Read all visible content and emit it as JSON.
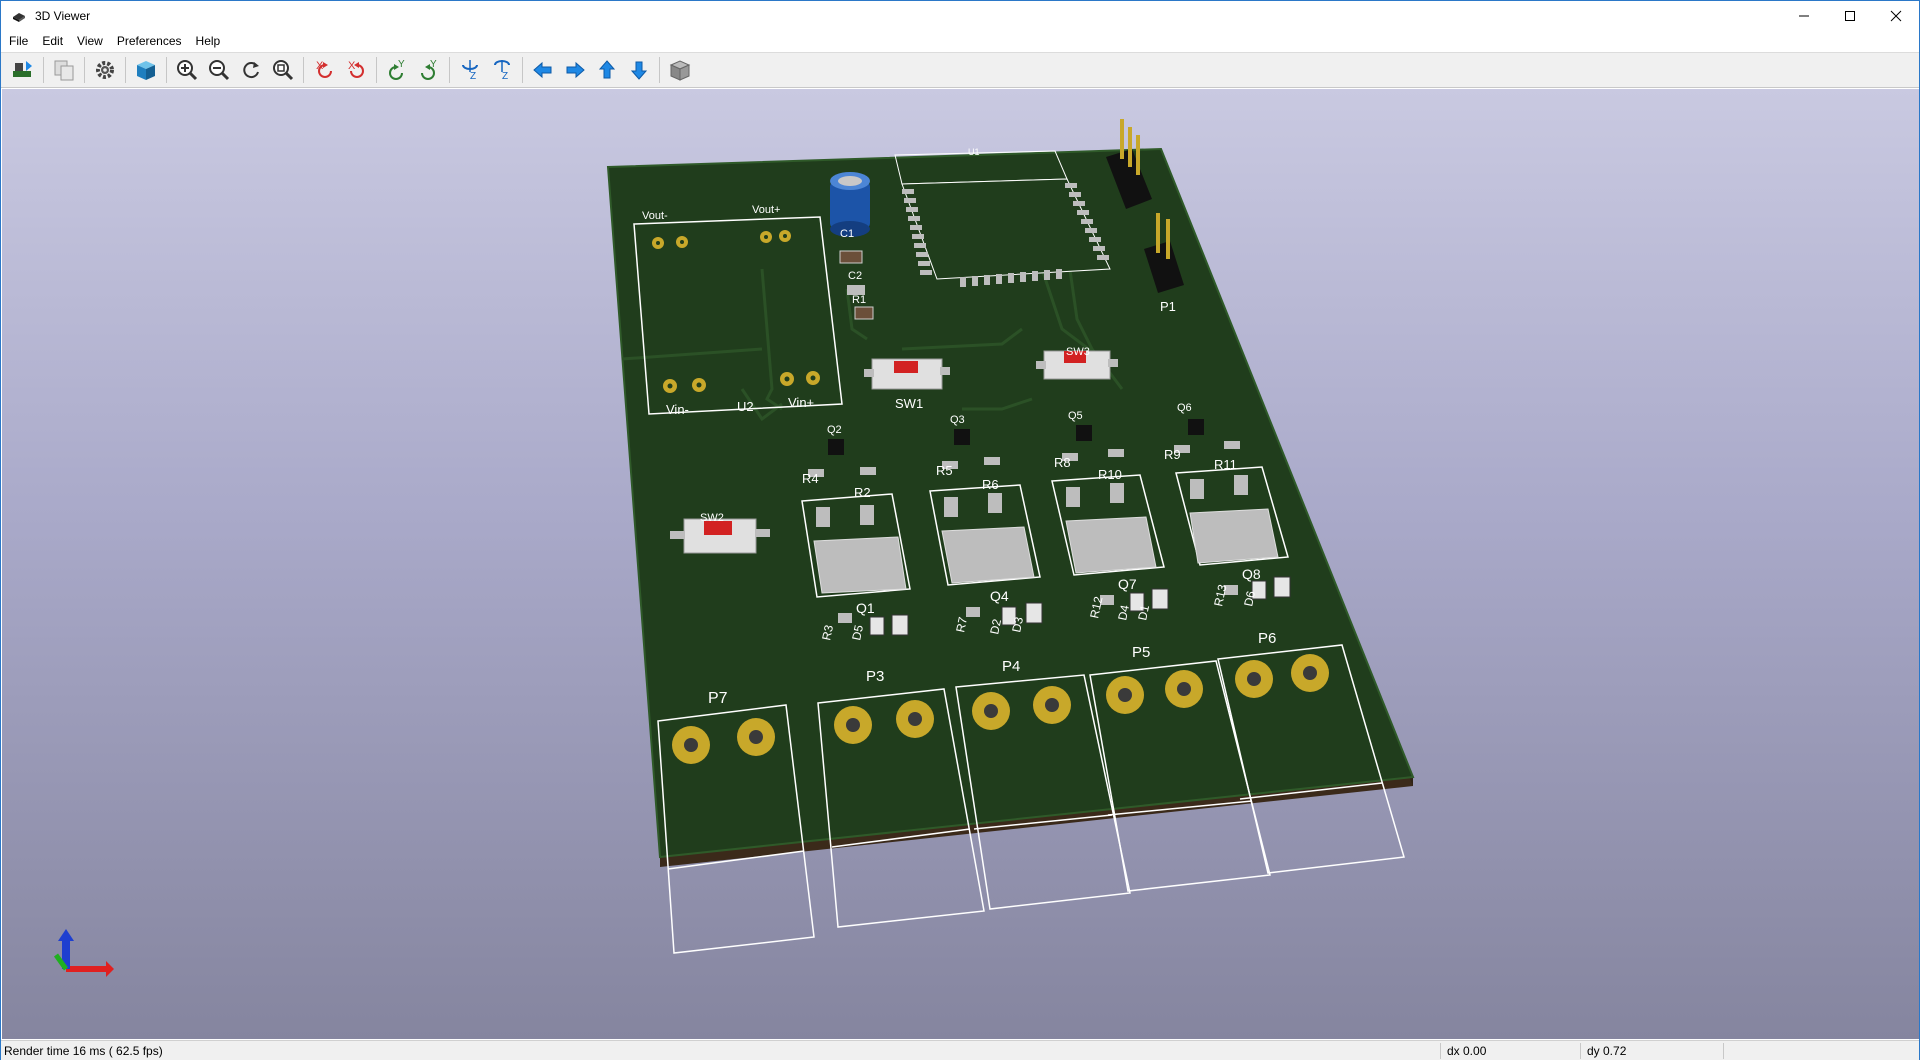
{
  "window": {
    "title": "3D Viewer",
    "icons": {
      "app": "3d-viewer-app-icon",
      "minimize": "minimize-icon",
      "maximize": "maximize-icon",
      "close": "close-icon"
    }
  },
  "menu": [
    "File",
    "Edit",
    "View",
    "Preferences",
    "Help"
  ],
  "toolbar": {
    "buttons": [
      "reload-board-icon",
      "copy-to-clipboard-icon",
      "settings-gear-icon",
      "raytracing-cube-icon",
      "zoom-in-icon",
      "zoom-out-icon",
      "redraw-icon",
      "zoom-fit-icon",
      "rotate-x-cw-icon",
      "rotate-x-ccw-icon",
      "rotate-y-cw-icon",
      "rotate-y-ccw-icon",
      "rotate-z-cw-icon",
      "rotate-z-ccw-icon",
      "pan-left-icon",
      "pan-right-icon",
      "pan-up-icon",
      "pan-down-icon",
      "ortho-view-icon"
    ]
  },
  "pcb": {
    "labels": {
      "vout_minus": "Vout-",
      "vout_plus": "Vout+",
      "vin_minus": "Vin-",
      "vin_plus": "Vin+",
      "u2": "U2",
      "u1": "U1",
      "c1": "C1",
      "c2": "C2",
      "r1": "R1",
      "sw1": "SW1",
      "sw2": "SW2",
      "sw3": "SW3",
      "p1": "P1",
      "q1": "Q1",
      "q2": "Q2",
      "q3": "Q3",
      "q4": "Q4",
      "q5": "Q5",
      "q6": "Q6",
      "q7": "Q7",
      "q8": "Q8",
      "r2": "R2",
      "r3": "R3",
      "r4": "R4",
      "r5": "R5",
      "r6": "R6",
      "r7": "R7",
      "r8": "R8",
      "r9": "R9",
      "r10": "R10",
      "r11": "R11",
      "r12": "R12",
      "r13": "R13",
      "d1": "D1",
      "d2": "D2",
      "d3": "D3",
      "d4": "D4",
      "d5": "D5",
      "d6": "D6",
      "p3": "P3",
      "p4": "P4",
      "p5": "P5",
      "p6": "P6",
      "p7": "P7"
    },
    "colors": {
      "soldermask": "#203d1c",
      "silkscreen": "#ffffff",
      "pad_gold": "#c8a82a",
      "pad_silver": "#bdbdbd",
      "button_red": "#d22222"
    },
    "axis_icon": "xyz-axis-indicator-icon"
  },
  "status": {
    "render": "Render time 16 ms ( 62.5 fps)",
    "dx": "dx 0.00",
    "dy": "dy 0.72"
  }
}
